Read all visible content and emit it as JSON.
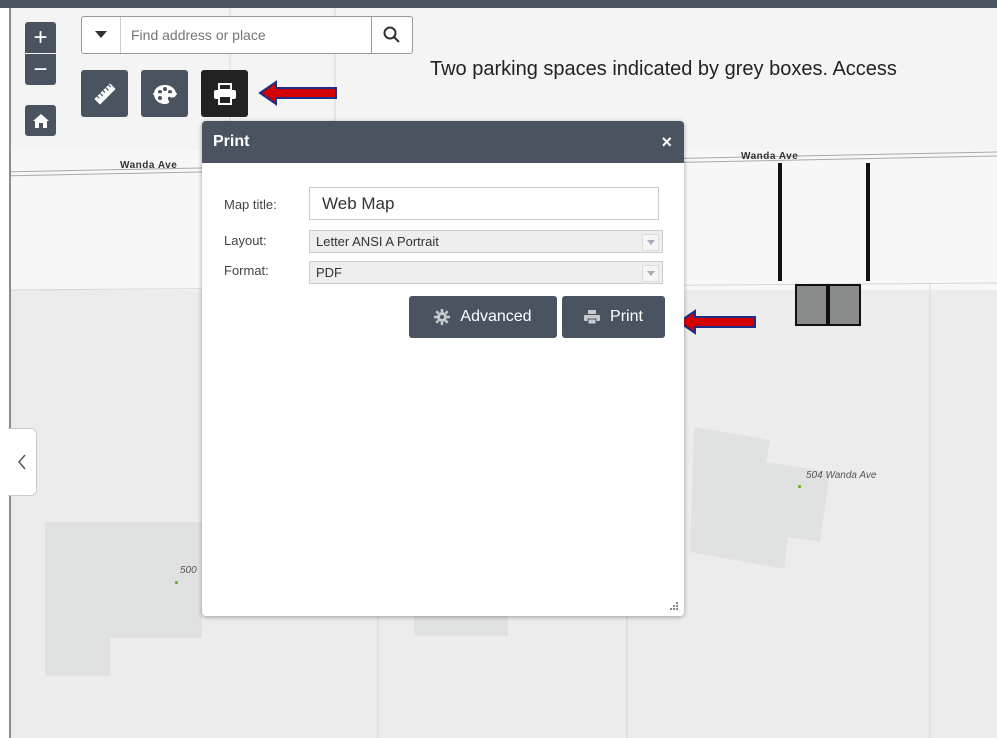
{
  "map": {
    "annotation": "Two parking spaces indicated by grey boxes. Access",
    "street_labels": [
      "Wanda Ave",
      "Wanda Ave"
    ],
    "address_labels": [
      "504 Wanda Ave",
      "500"
    ]
  },
  "toolbar": {
    "zoom_in": "+",
    "zoom_out": "−",
    "measure_icon": "ruler-icon",
    "basemap_icon": "palette-icon",
    "print_icon": "printer-icon",
    "home_icon": "home-icon"
  },
  "search": {
    "placeholder": "Find address or place"
  },
  "print_panel": {
    "title": "Print",
    "close": "×",
    "map_title_label": "Map title:",
    "map_title_value": "Web Map",
    "layout_label": "Layout:",
    "layout_value": "Letter ANSI A Portrait",
    "format_label": "Format:",
    "format_value": "PDF",
    "advanced_label": "Advanced",
    "print_label": "Print"
  },
  "colors": {
    "header": "#4a5461",
    "arrow_red": "#d40000",
    "arrow_blue": "#1c2e8a"
  }
}
